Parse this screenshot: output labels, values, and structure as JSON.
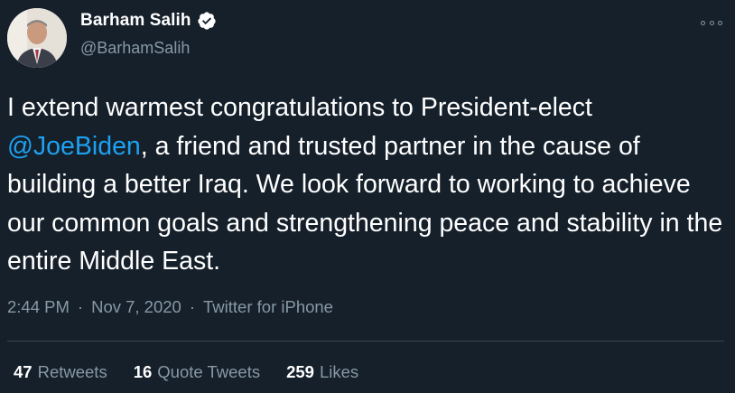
{
  "author": {
    "display_name": "Barham Salih",
    "handle": "@BarhamSalih",
    "verified": true
  },
  "tweet": {
    "text_before": "I extend warmest congratulations to President-elect ",
    "mention": "@JoeBiden",
    "text_after": ", a friend and trusted partner in the cause of building a better Iraq. We look forward to working to achieve our common goals and strengthening peace and stability in the entire Middle East."
  },
  "meta": {
    "time": "2:44 PM",
    "separator": "·",
    "date": "Nov 7, 2020",
    "source": "Twitter for iPhone"
  },
  "stats": {
    "retweets_count": "47",
    "retweets_label": "Retweets",
    "quotes_count": "16",
    "quotes_label": "Quote Tweets",
    "likes_count": "259",
    "likes_label": "Likes"
  },
  "icons": {
    "verified": "verified-badge-icon",
    "more": "more-options-icon"
  },
  "colors": {
    "background": "#15202b",
    "text": "#ffffff",
    "secondary_text": "#8899a6",
    "link": "#1da1f2",
    "divider": "#38444d"
  }
}
